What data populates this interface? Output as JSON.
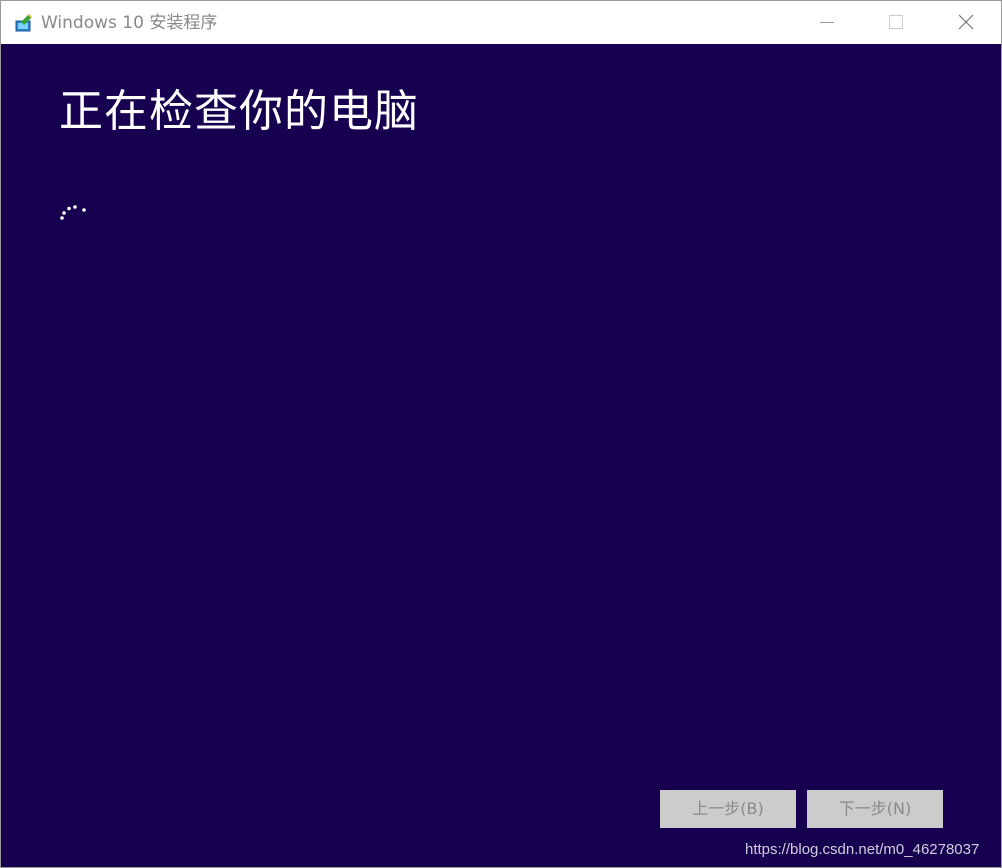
{
  "window": {
    "title": "Windows 10 安装程序",
    "icon": "windows-setup-icon",
    "controls": {
      "minimize_icon": "minimize-icon",
      "maximize_icon": "maximize-icon",
      "close_icon": "close-icon"
    }
  },
  "main": {
    "heading": "正在检查你的电脑",
    "loading_indicator": "loading-spinner-icon"
  },
  "footer": {
    "back_button": "上一步(B)",
    "next_button": "下一步(N)",
    "watermark": "https://blog.csdn.net/m0_46278037"
  },
  "colors": {
    "background": "#170050",
    "heading_text": "#ffffff",
    "button_disabled_bg": "#cccccc",
    "button_disabled_text": "#8a8a8a"
  }
}
